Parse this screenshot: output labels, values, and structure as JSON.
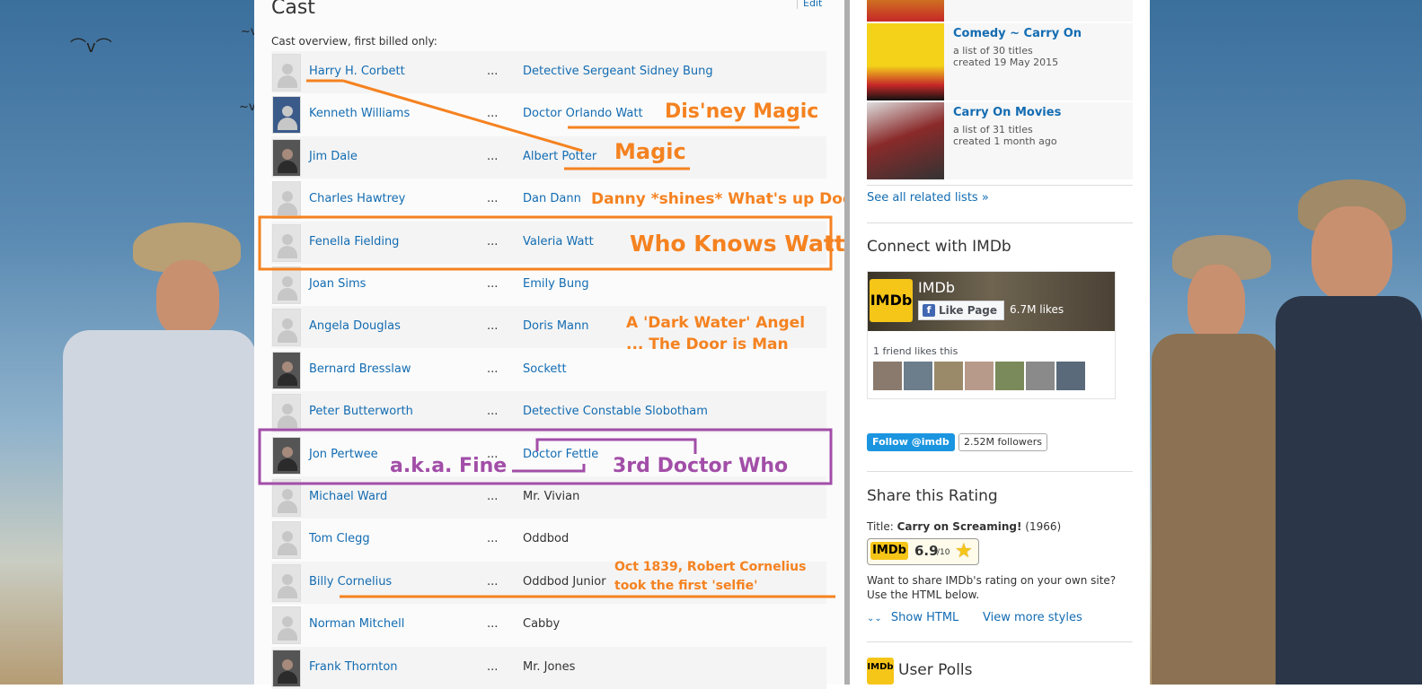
{
  "cast": {
    "title": "Cast",
    "edit": "Edit",
    "overview": "Cast overview, first billed only:",
    "rows": [
      {
        "actor": "Harry H. Corbett",
        "character": "Detective Sergeant Sidney Bung",
        "linked": true
      },
      {
        "actor": "Kenneth Williams",
        "character_prefix": "Doctor ",
        "character": "Orlando Watt",
        "linked": true
      },
      {
        "actor": "Jim Dale",
        "character": "Albert Potter",
        "linked": true
      },
      {
        "actor": "Charles Hawtrey",
        "character": "Dan Dann",
        "linked": true
      },
      {
        "actor": "Fenella Fielding",
        "character": "Valeria Watt",
        "linked": true
      },
      {
        "actor": "Joan Sims",
        "character": "Emily Bung",
        "linked": true
      },
      {
        "actor": "Angela Douglas",
        "character": "Doris Mann",
        "linked": true
      },
      {
        "actor": "Bernard Bresslaw",
        "character": "Sockett",
        "linked": true
      },
      {
        "actor": "Peter Butterworth",
        "character": "Detective Constable Slobotham",
        "linked": true
      },
      {
        "actor": "Jon Pertwee",
        "character": "Doctor Fettle",
        "linked": true
      },
      {
        "actor": "Michael Ward",
        "character": "Mr. Vivian",
        "linked": false
      },
      {
        "actor": "Tom Clegg",
        "character": "Oddbod",
        "linked": false
      },
      {
        "actor": "Billy Cornelius",
        "character": "Oddbod Junior",
        "linked": false
      },
      {
        "actor": "Norman Mitchell",
        "character": "Cabby",
        "linked": false
      },
      {
        "actor": "Frank Thornton",
        "character": "Mr. Jones",
        "linked": false
      }
    ],
    "ellipsis": "..."
  },
  "annotations": {
    "disney": "Dis'ney Magic",
    "magic": "Magic",
    "danny": "Danny *shines* What's up Doc?",
    "who_knows_watt": "Who Knows Watt",
    "dark_water_1": "A 'Dark Water' Angel",
    "dark_water_2": "... The Door is Man",
    "aka_fine": "a.k.a. Fine",
    "third_doctor": "3rd Doctor Who",
    "selfie_1": "Oct 1839, Robert Cornelius",
    "selfie_2": "took the first 'selfie'"
  },
  "sidebar": {
    "lists": [
      {
        "title": "Comedy ~ Carry On",
        "count": "a list of 30 titles",
        "created": "created 19 May 2015"
      },
      {
        "title": "Carry On Movies",
        "count": "a list of 31 titles",
        "created": "created 1 month ago"
      }
    ],
    "see_all": "See all related lists »",
    "connect_title": "Connect with IMDb",
    "fb": {
      "page_name": "IMDb",
      "like_label": "Like Page",
      "likes": "6.7M likes",
      "friends": "1 friend likes this"
    },
    "twitter": {
      "follow": "Follow @imdb",
      "followers": "2.52M followers"
    },
    "share_title": "Share this Rating",
    "title_label": "Title:",
    "movie_title": "Carry on Screaming!",
    "movie_year": "(1966)",
    "rating": "6.9",
    "rating_scale": "/10",
    "share_text_1": "Want to share IMDb's rating on your own site?",
    "share_text_2": "Use the HTML below.",
    "show_html": "Show HTML",
    "more_styles": "View more styles",
    "polls_title": "User Polls",
    "imdb_logo": "IMDb"
  },
  "colors": {
    "link": "#136cb2",
    "annotation_orange": "#f58220",
    "annotation_purple": "#a24ea8"
  }
}
